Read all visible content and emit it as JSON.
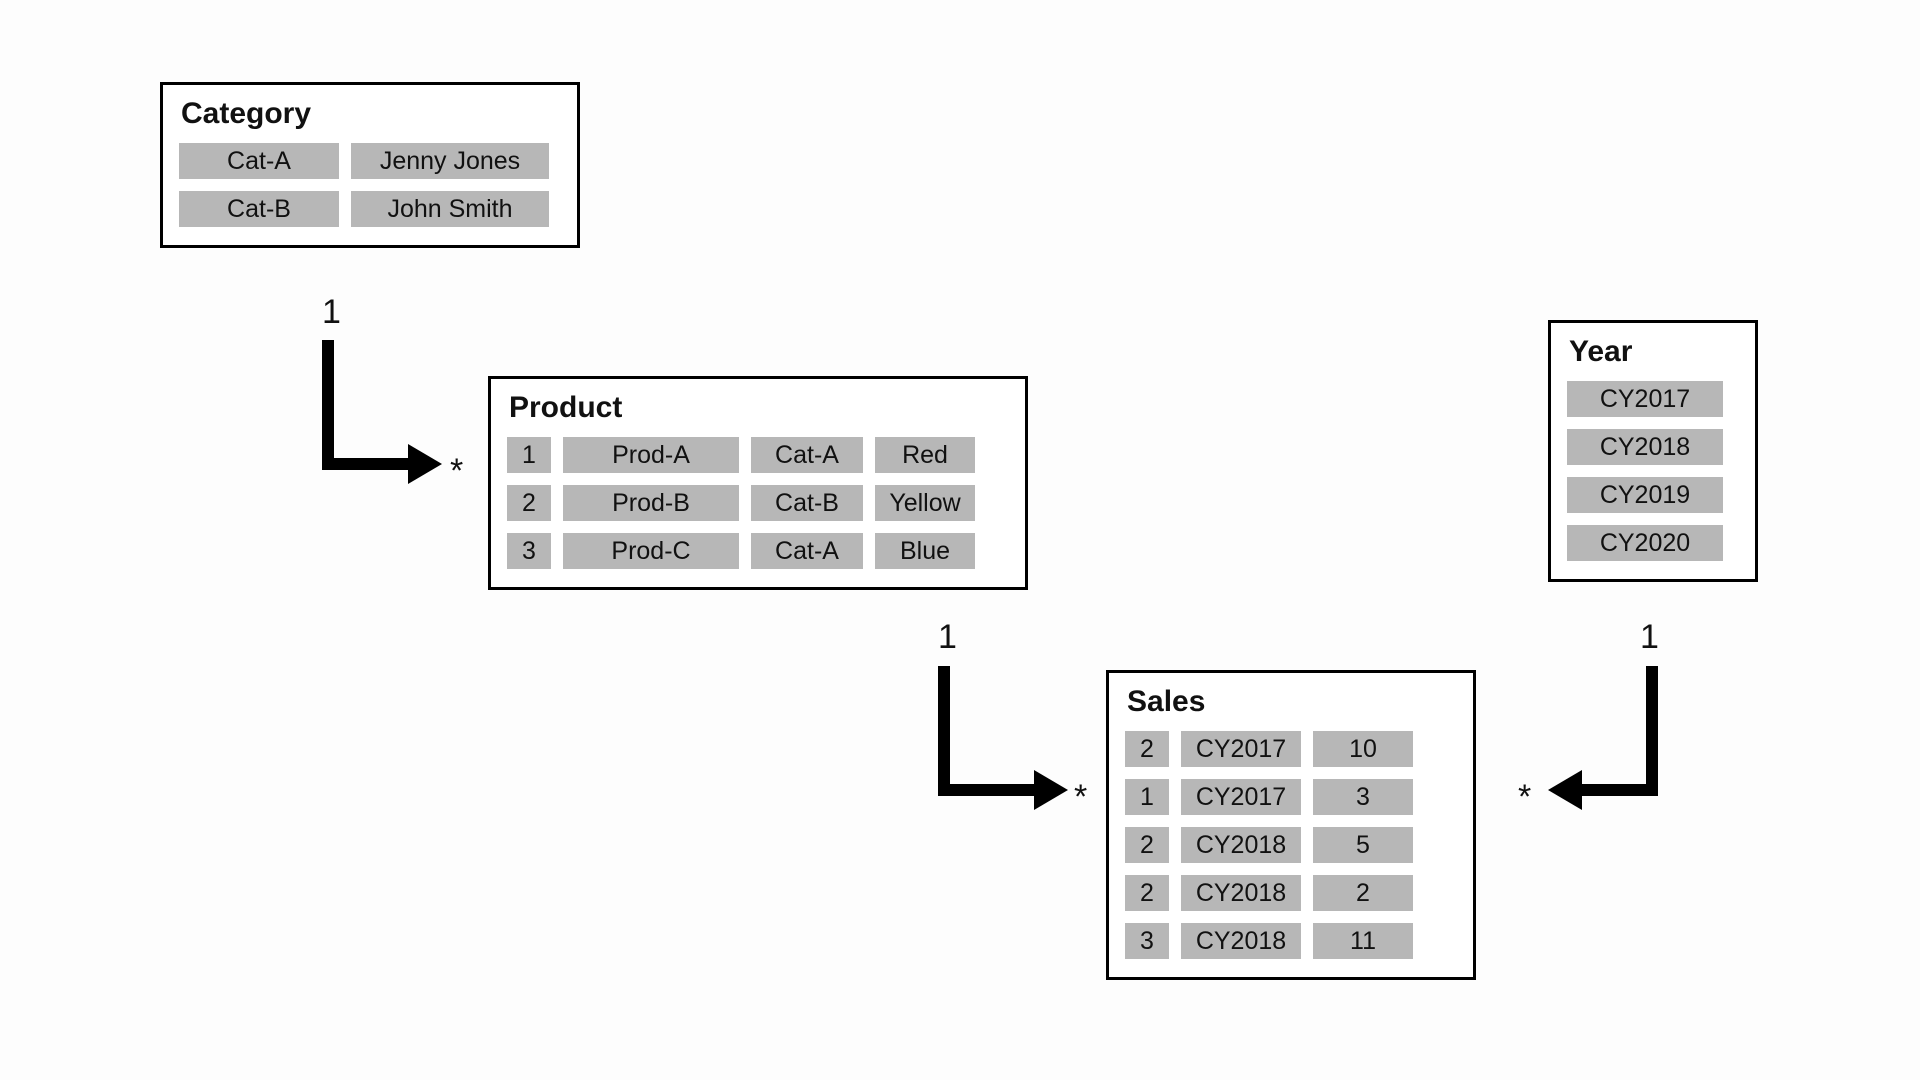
{
  "entities": {
    "category": {
      "title": "Category",
      "rows": [
        {
          "code": "Cat-A",
          "owner": "Jenny Jones"
        },
        {
          "code": "Cat-B",
          "owner": "John Smith"
        }
      ]
    },
    "product": {
      "title": "Product",
      "rows": [
        {
          "id": "1",
          "name": "Prod-A",
          "cat": "Cat-A",
          "color": "Red"
        },
        {
          "id": "2",
          "name": "Prod-B",
          "cat": "Cat-B",
          "color": "Yellow"
        },
        {
          "id": "3",
          "name": "Prod-C",
          "cat": "Cat-A",
          "color": "Blue"
        }
      ]
    },
    "sales": {
      "title": "Sales",
      "rows": [
        {
          "pid": "2",
          "year": "CY2017",
          "qty": "10"
        },
        {
          "pid": "1",
          "year": "CY2017",
          "qty": "3"
        },
        {
          "pid": "2",
          "year": "CY2018",
          "qty": "5"
        },
        {
          "pid": "2",
          "year": "CY2018",
          "qty": "2"
        },
        {
          "pid": "3",
          "year": "CY2018",
          "qty": "11"
        }
      ]
    },
    "year": {
      "title": "Year",
      "rows": [
        {
          "y": "CY2017"
        },
        {
          "y": "CY2018"
        },
        {
          "y": "CY2019"
        },
        {
          "y": "CY2020"
        }
      ]
    }
  },
  "relations": {
    "category_to_product": {
      "from_card": "1",
      "to_card": "*"
    },
    "product_to_sales": {
      "from_card": "1",
      "to_card": "*"
    },
    "year_to_sales": {
      "from_card": "1",
      "to_card": "*"
    }
  }
}
